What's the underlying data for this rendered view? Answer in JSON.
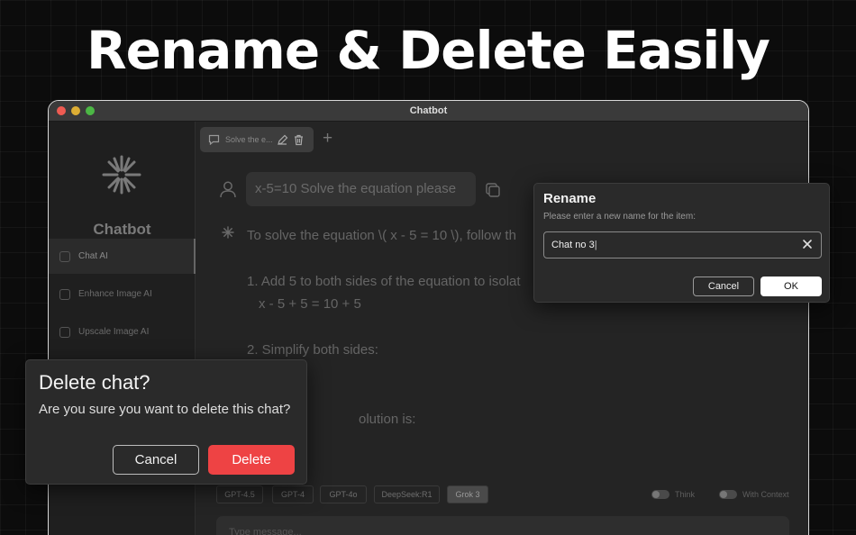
{
  "headline": "Rename & Delete Easily",
  "window": {
    "title": "Chatbot"
  },
  "sidebar": {
    "logo_text": "Chatbot",
    "items": [
      {
        "label": "Chat AI",
        "icon": "chat-icon",
        "active": true
      },
      {
        "label": "Enhance Image AI",
        "icon": "enhance-image-icon"
      },
      {
        "label": "Upscale Image AI",
        "icon": "upscale-image-icon"
      }
    ]
  },
  "tabs": [
    {
      "label": "Solve the e..."
    }
  ],
  "chat": {
    "user_message": "x-5=10 Solve the equation please",
    "ai_lines": [
      "To solve the equation \\( x - 5 = 10 \\), follow th",
      "1. Add 5 to both sides of the equation to isolat",
      "x - 5 + 5 = 10 + 5",
      "2. Simplify both sides:",
      "olution is:"
    ]
  },
  "models": [
    {
      "label": "GPT-4.5"
    },
    {
      "label": "GPT-4"
    },
    {
      "label": "GPT-4o"
    },
    {
      "label": "DeepSeek:R1"
    },
    {
      "label": "Grok 3",
      "selected": true
    }
  ],
  "toggles": {
    "think": "Think",
    "with_context": "With Context"
  },
  "message_input": {
    "placeholder": "Type message..."
  },
  "rename_dialog": {
    "title": "Rename",
    "subtitle": "Please enter a new name for the item:",
    "value": "Chat no 3",
    "cancel_label": "Cancel",
    "ok_label": "OK"
  },
  "delete_dialog": {
    "title": "Delete chat?",
    "message": "Are you sure you want to delete this chat?",
    "cancel_label": "Cancel",
    "delete_label": "Delete",
    "delete_color": "#ee4344"
  }
}
